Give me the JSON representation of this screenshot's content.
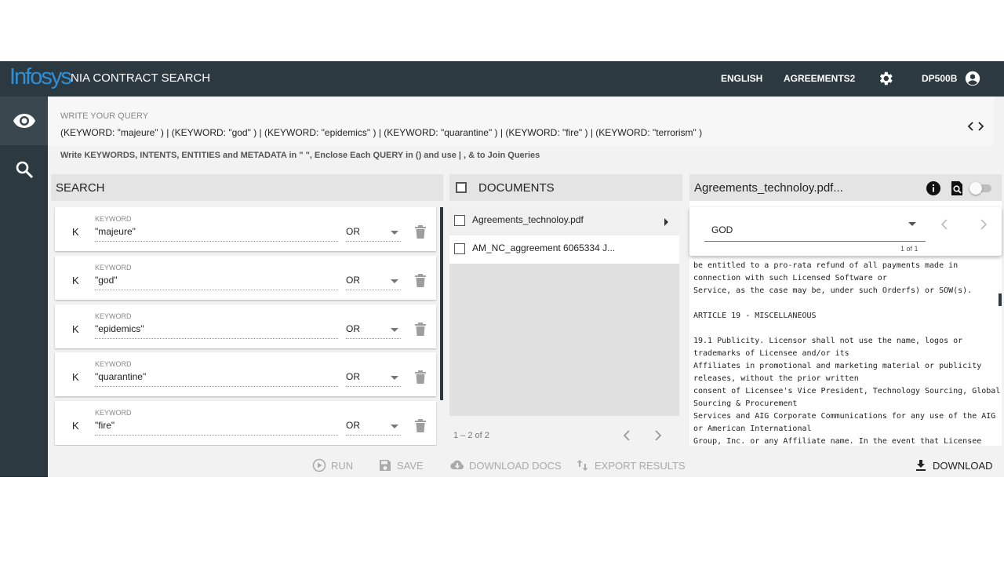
{
  "header": {
    "logo": "Infosys",
    "app_title": "NIA CONTRACT SEARCH",
    "language": "ENGLISH",
    "workspace": "AGREEMENTS2",
    "user": "DP500B"
  },
  "query": {
    "label": "WRITE YOUR QUERY",
    "text": "(KEYWORD: \"majeure\" ) | (KEYWORD: \"god\" ) | (KEYWORD: \"epidemics\" ) | (KEYWORD: \"quarantine\" ) | (KEYWORD: \"fire\" ) | (KEYWORD: \"terrorism\" )",
    "hint": "Write KEYWORDS, INTENTS, ENTITIES and METADATA in \" \", Enclose Each QUERY in () and use | , & to Join Queries"
  },
  "search": {
    "title": "SEARCH",
    "items": [
      {
        "type": "K",
        "label": "KEYWORD",
        "value": "\"majeure\"",
        "operator": "OR"
      },
      {
        "type": "K",
        "label": "KEYWORD",
        "value": "\"god\"",
        "operator": "OR"
      },
      {
        "type": "K",
        "label": "KEYWORD",
        "value": "\"epidemics\"",
        "operator": "OR"
      },
      {
        "type": "K",
        "label": "KEYWORD",
        "value": "\"quarantine\"",
        "operator": "OR"
      },
      {
        "type": "K",
        "label": "KEYWORD",
        "value": "\"fire\"",
        "operator": "OR"
      }
    ]
  },
  "toolbar": {
    "run": "RUN",
    "save": "SAVE",
    "download_docs": "DOWNLOAD DOCS",
    "export_results": "EXPORT RESULTS",
    "download": "DOWNLOAD"
  },
  "documents": {
    "title": "DOCUMENTS",
    "items": [
      {
        "name": "Agreements_technoloy.pdf"
      },
      {
        "name": "AM_NC_aggreement 6065334 J..."
      }
    ],
    "pager": "1 – 2 of 2"
  },
  "viewer": {
    "title": "Agreements_technoloy.pdf...",
    "term": "GOD",
    "term_count": "1 of 1",
    "lines": [
      "be entitled to a pro-rata refund of all payments made in",
      "connection with such Licensed Software or",
      "Service, as the case may be, under such Orderfs) or SOW(s).",
      "",
      "ARTICLE 19 - MISCELLANEOUS",
      "",
      "19.1   Publicity. Licensor shall not use the name, logos or",
      "trademarks of Licensee and/or its",
      "Affiliates in promotional and marketing material or publicity",
      "releases, without the prior written",
      "consent of Licensee's Vice President, Technology Sourcing, Global",
      "Sourcing & Procurement",
      "Services and AIG Corporate Communications for any use of the AIG",
      "or American International",
      "Group, Inc. or any Affiliate name. In the event that Licensee"
    ]
  },
  "colors": {
    "header_bg": "#2d3940",
    "logo": "#2f8fd6",
    "panel_header": "#e4e4e4",
    "disabled_text": "#aaaaaa"
  }
}
